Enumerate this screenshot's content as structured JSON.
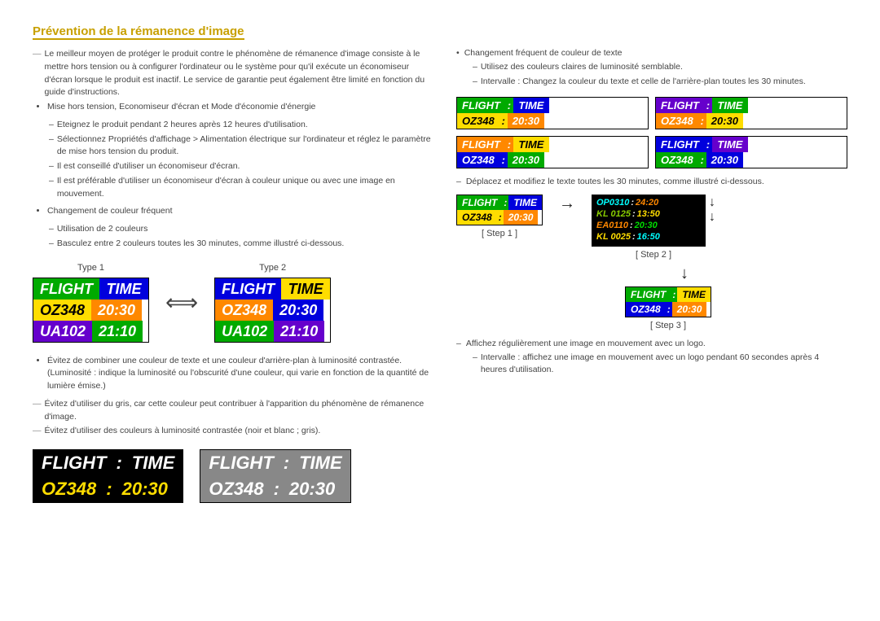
{
  "title": "Prévention de la rémanence d'image",
  "left": {
    "intro_dash": "Le meilleur moyen de protéger le produit contre le phénomène de rémanence d'image consiste à le mettre hors tension ou à configurer l'ordinateur ou le système pour qu'il exécute un économiseur d'écran lorsque le produit est inactif. Le service de garantie peut également être limité en fonction du guide d'instructions.",
    "bullet1": "Mise hors tension, Economiseur d'écran et Mode d'économie d'énergie",
    "sub1a": "Eteignez le produit pendant 2 heures après 12 heures d'utilisation.",
    "sub1b": "Sélectionnez Propriétés d'affichage > Alimentation électrique sur l'ordinateur et réglez le paramètre de mise hors tension du produit.",
    "sub1c": "Il est conseillé d'utiliser un économiseur d'écran.",
    "sub1d": "Il est préférable d'utiliser un économiseur d'écran à couleur unique ou avec une image en mouvement.",
    "bullet2": "Changement de couleur fréquent",
    "sub2a": "Utilisation de 2 couleurs",
    "sub2b": "Basculez entre 2 couleurs toutes les 30 minutes, comme illustré ci-dessous.",
    "type1": "Type 1",
    "type2": "Type 2",
    "bullet3": "Évitez de combiner une couleur de texte et une couleur d'arrière-plan à luminosité contrastée. (Luminosité : indique la luminosité ou l'obscurité d'une couleur, qui varie en fonction de la quantité de lumière émise.)",
    "dash2": "Évitez d'utiliser du gris, car cette couleur peut contribuer à l'apparition du phénomène de rémanence d'image.",
    "dash3": "Évitez d'utiliser des couleurs à luminosité contrastée (noir et blanc ; gris)."
  },
  "right": {
    "bullet1": "Changement fréquent de couleur de texte",
    "sub1a": "Utilisez des couleurs claires de luminosité semblable.",
    "sub1b": "Intervalle : Changez la couleur du texte et celle de l'arrière-plan toutes les 30 minutes.",
    "dash1": "Déplacez et modifiez le texte toutes les 30 minutes, comme illustré ci-dessous.",
    "step1": "[ Step 1 ]",
    "step2": "[ Step 2 ]",
    "step3": "[ Step 3 ]",
    "dash2": "Affichez régulièrement une image en mouvement avec un logo.",
    "sub2": "Intervalle : affichez une image en mouvement avec un logo pendant 60 secondes après 4 heures d'utilisation."
  },
  "boards": {
    "flight": "FLIGHT",
    "time": "TIME",
    "oz348": "OZ348",
    "time_val": "20:30",
    "ua102": "UA102",
    "ua102_time": "21:10",
    "colon": ":"
  }
}
